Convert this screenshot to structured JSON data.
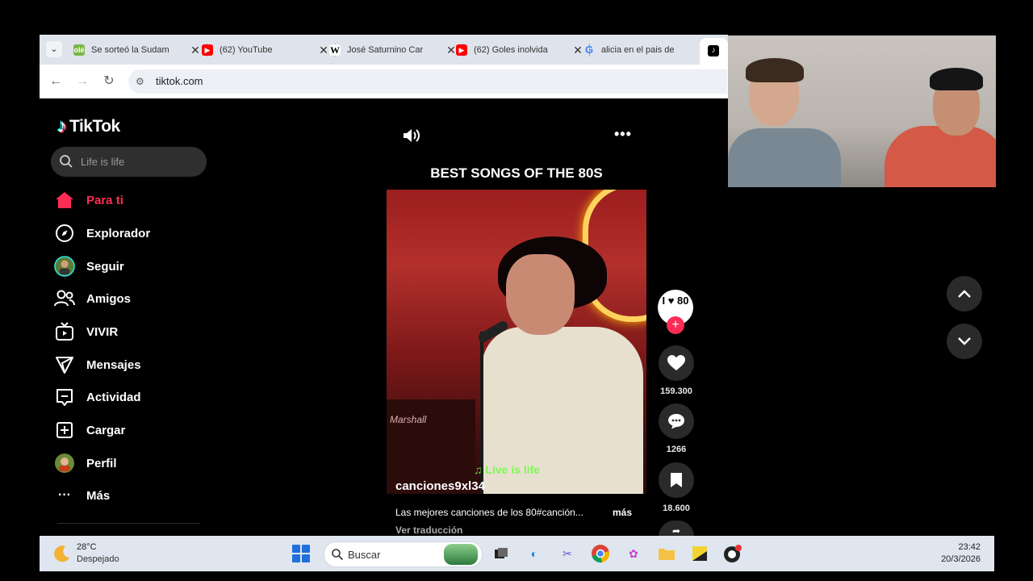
{
  "browser": {
    "tabs": [
      {
        "title": "Se sorteó la Sudam",
        "favicon": "ole-icon",
        "color": "#7ab648"
      },
      {
        "title": "(62) YouTube",
        "favicon": "youtube-icon",
        "color": "#ff0000"
      },
      {
        "title": "José Saturnino Car",
        "favicon": "wikipedia-icon",
        "color": "#ffffff"
      },
      {
        "title": "(62) Goles inolvida",
        "favicon": "youtube-icon",
        "color": "#ff0000"
      },
      {
        "title": "alicia en el pais de",
        "favicon": "google-icon",
        "color": "#ffffff"
      }
    ],
    "url": "tiktok.com"
  },
  "tiktok": {
    "logo_text": "TikTok",
    "search_placeholder": "Life is life",
    "nav": [
      {
        "label": "Para ti",
        "icon": "home-icon",
        "active": true
      },
      {
        "label": "Explorador",
        "icon": "compass-icon"
      },
      {
        "label": "Seguir",
        "icon": "avatar-icon"
      },
      {
        "label": "Amigos",
        "icon": "friends-icon"
      },
      {
        "label": "VIVIR",
        "icon": "live-tv-icon"
      },
      {
        "label": "Mensajes",
        "icon": "send-icon"
      },
      {
        "label": "Actividad",
        "icon": "activity-icon"
      },
      {
        "label": "Cargar",
        "icon": "upload-icon"
      },
      {
        "label": "Perfil",
        "icon": "profile-avatar-icon"
      },
      {
        "label": "Más",
        "icon": "more-dots-icon"
      }
    ],
    "video": {
      "title": "BEST SONGS OF THE 80S",
      "author": "canciones9xl34",
      "overlay_lyric": "♫ Live is life",
      "description": "Las mejores canciones de los 80#canción...",
      "more_label": "más",
      "translate_label": "Ver traducción",
      "creator_avatar_text": "I ♥ 80",
      "likes": "159.300",
      "comments": "1266",
      "saves": "18.600"
    },
    "accent": "#fe2c55"
  },
  "taskbar": {
    "temperature": "28°C",
    "condition": "Despejado",
    "search_placeholder": "Buscar",
    "time": "23:42",
    "date": "20/3/2026"
  }
}
